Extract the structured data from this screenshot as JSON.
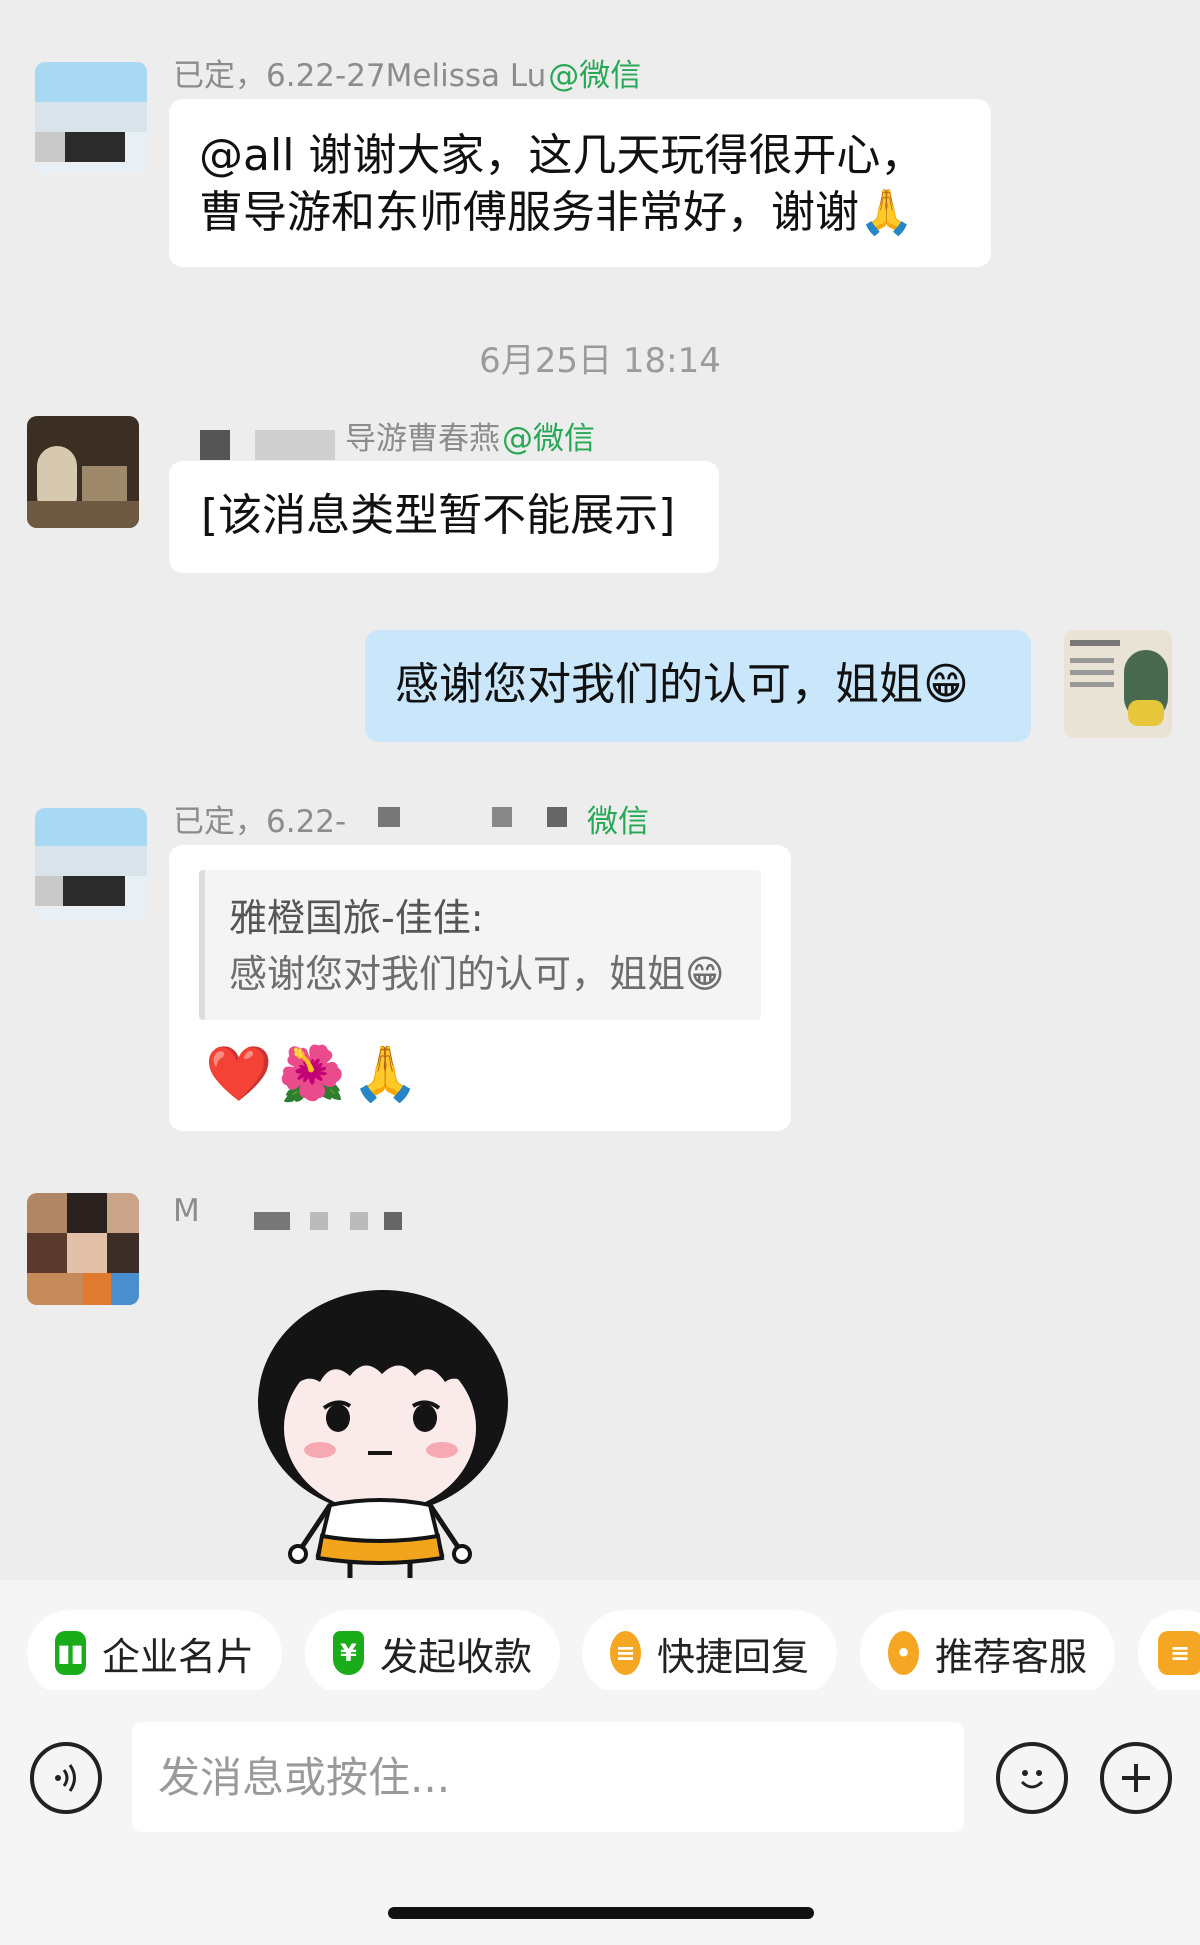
{
  "messages": [
    {
      "sender": "已定，6.22-27Melissa Lu",
      "sender_tag": "@微信",
      "lines": [
        "@all 谢谢大家，这几天玩得很开心，",
        "曹导游和东师傅服务非常好，谢谢🙏"
      ]
    },
    {
      "sender": "导游曹春燕",
      "sender_tag": "@微信",
      "text": "[该消息类型暂不能展示]"
    },
    {
      "mine": true,
      "text": "感谢您对我们的认可，姐姐😁"
    },
    {
      "sender": "已定，6.22-",
      "sender_tag": "微信",
      "quote_name": "雅橙国旅-佳佳:",
      "quote_text": "感谢您对我们的认可，姐姐😁",
      "emojis": "❤️🌺🙏"
    },
    {
      "sender": "M"
    }
  ],
  "timestamp": "6月25日 18:14",
  "toolbar": {
    "chips": [
      "企业名片",
      "发起收款",
      "快捷回复",
      "推荐客服"
    ]
  },
  "input": {
    "placeholder": "发消息或按住..."
  },
  "colors": {
    "background": "#ededed",
    "my_bubble": "#c9e6fb",
    "wechat_green": "#27a855",
    "chip_green": "#1aad19",
    "chip_orange": "#f5a623"
  }
}
